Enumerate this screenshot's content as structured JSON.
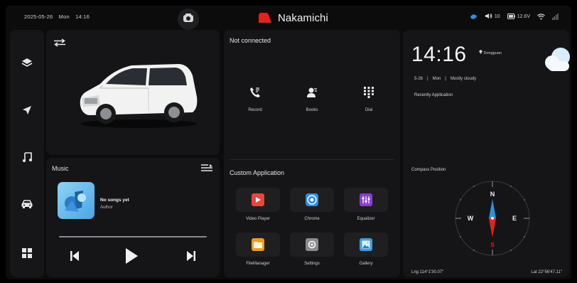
{
  "status_bar": {
    "date": "2025-05-26",
    "weekday": "Mon",
    "time": "14:16",
    "brand": "Nakamichi",
    "volume": "10",
    "battery": "12.6V",
    "icons": [
      "bluetooth-icon",
      "volume-icon",
      "battery-icon",
      "wifi-icon",
      "signal-icon"
    ]
  },
  "sidebar": {
    "items": [
      {
        "name": "layers",
        "icon": "layers-icon"
      },
      {
        "name": "navigation",
        "icon": "navigation-icon"
      },
      {
        "name": "music",
        "icon": "music-note-icon"
      },
      {
        "name": "car",
        "icon": "car-icon"
      },
      {
        "name": "apps",
        "icon": "apps-grid-icon"
      }
    ]
  },
  "music": {
    "title": "Music",
    "song": "No songs yet",
    "author": "Author",
    "progress": 0
  },
  "phone": {
    "status": "Not connected",
    "buttons": [
      {
        "label": "Record",
        "icon": "call-record-icon"
      },
      {
        "label": "Books",
        "icon": "contacts-icon"
      },
      {
        "label": "Dial",
        "icon": "dialpad-icon"
      }
    ]
  },
  "custom": {
    "title": "Custom Application",
    "apps": [
      {
        "label": "Video Player",
        "icon": "video-player-icon",
        "color": "#e8453c"
      },
      {
        "label": "Chrome",
        "icon": "chrome-icon",
        "color": "#2f8fe0"
      },
      {
        "label": "Equalizer",
        "icon": "equalizer-icon",
        "color": "#8a3fd1"
      },
      {
        "label": "FileManager",
        "icon": "folder-icon",
        "color": "#f39a1e"
      },
      {
        "label": "Settings",
        "icon": "settings-icon",
        "color": "#8c8c8c"
      },
      {
        "label": "Gallery",
        "icon": "gallery-icon",
        "color": "#3aa0e8"
      }
    ]
  },
  "weather": {
    "time": "14:16",
    "location": "Dongguan",
    "date": "5-26",
    "weekday": "Mon",
    "condition": "Mostly cloudy",
    "recent": "Recently Application",
    "icon": "cloud-icon"
  },
  "compass": {
    "title": "Compass Position",
    "n": "N",
    "w": "W",
    "e": "E",
    "s": "S",
    "lng": "Lng 114°1'30.07\"",
    "lat": "Lat 22°56'47.11\""
  },
  "colors": {
    "panel": "#151517",
    "background": "#0c0c0d",
    "accent_red": "#e3231b"
  }
}
